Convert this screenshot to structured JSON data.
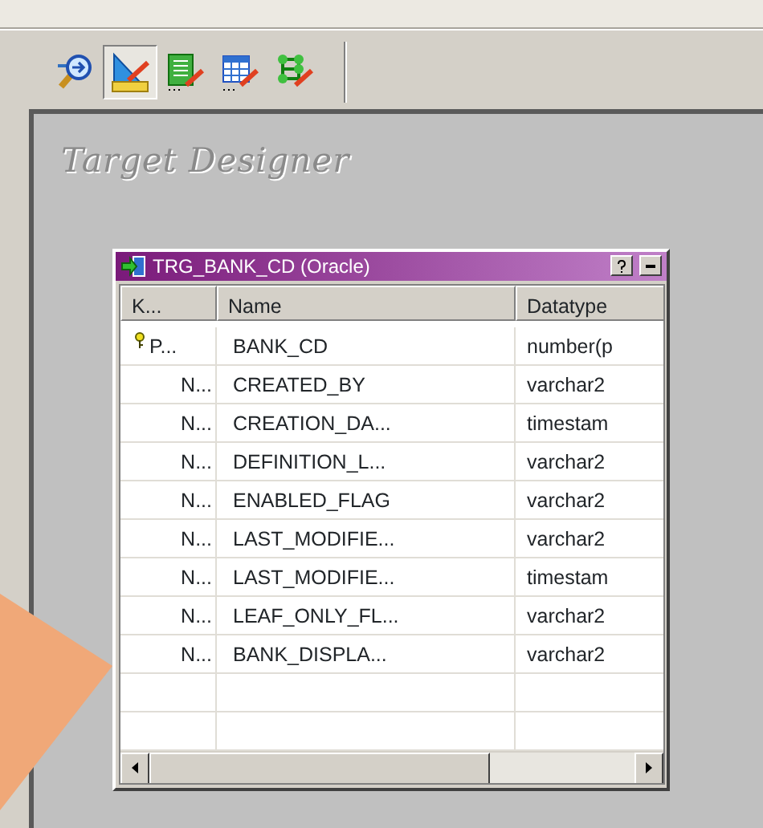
{
  "toolbar": {
    "buttons": [
      {
        "kind": "find",
        "selected": false
      },
      {
        "kind": "designer",
        "selected": true
      },
      {
        "kind": "list",
        "selected": false
      },
      {
        "kind": "table",
        "selected": false
      },
      {
        "kind": "network",
        "selected": false
      }
    ]
  },
  "workspace": {
    "title": "Target Designer"
  },
  "table_window": {
    "title": "TRG_BANK_CD (Oracle)",
    "columns": [
      "K...",
      "Name",
      "Datatype"
    ],
    "rows": [
      {
        "key_icon": true,
        "cells": [
          "P...",
          "BANK_CD",
          "number(p"
        ]
      },
      {
        "key_icon": false,
        "cells": [
          "N...",
          "CREATED_BY",
          "varchar2"
        ]
      },
      {
        "key_icon": false,
        "cells": [
          "N...",
          "CREATION_DA...",
          "timestam"
        ]
      },
      {
        "key_icon": false,
        "cells": [
          "N...",
          "DEFINITION_L...",
          "varchar2"
        ]
      },
      {
        "key_icon": false,
        "cells": [
          "N...",
          "ENABLED_FLAG",
          "varchar2"
        ]
      },
      {
        "key_icon": false,
        "cells": [
          "N...",
          "LAST_MODIFIE...",
          "varchar2"
        ]
      },
      {
        "key_icon": false,
        "cells": [
          "N...",
          "LAST_MODIFIE...",
          "timestam"
        ]
      },
      {
        "key_icon": false,
        "cells": [
          "N...",
          "LEAF_ONLY_FL...",
          "varchar2"
        ]
      },
      {
        "key_icon": false,
        "cells": [
          "N...",
          "BANK_DISPLA...",
          "varchar2"
        ]
      }
    ]
  }
}
